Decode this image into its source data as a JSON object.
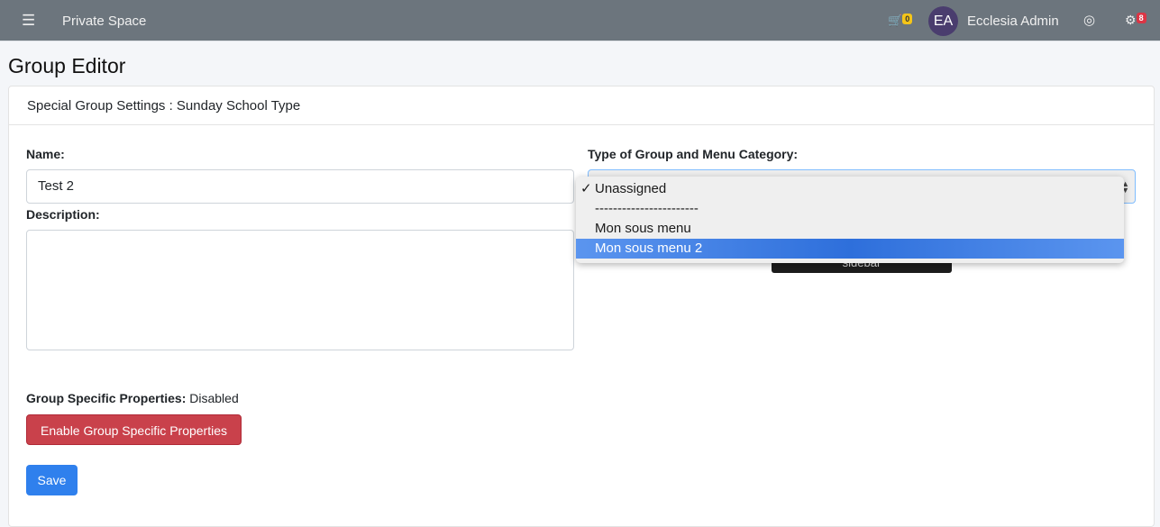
{
  "topbar": {
    "menu_icon": "hamburger-icon",
    "brand": "Private Space",
    "cart_count": "0",
    "avatar_initials": "EA",
    "user_name": "Ecclesia Admin",
    "settings_count": "8",
    "colors": {
      "bar": "#6c757d",
      "cart_badge": "#f5c518",
      "settings_badge": "#dc3545"
    }
  },
  "page": {
    "title": "Group Editor"
  },
  "card": {
    "header": "Special Group Settings : Sunday School Type"
  },
  "form": {
    "name_label": "Name:",
    "name_value": "Test 2",
    "description_label": "Description:",
    "description_value": "",
    "type_label": "Type of Group and Menu Category:",
    "type_options": [
      "Unassigned",
      "-----------------------",
      "Mon sous menu",
      "Mon sous menu 2"
    ],
    "type_checked": "Unassigned",
    "type_highlighted": "Mon sous menu 2",
    "hidden_button_label": "sidebar",
    "props_label": "Group Specific Properties:",
    "props_status": "Disabled",
    "enable_button": "Enable Group Specific Properties",
    "save_button": "Save"
  }
}
